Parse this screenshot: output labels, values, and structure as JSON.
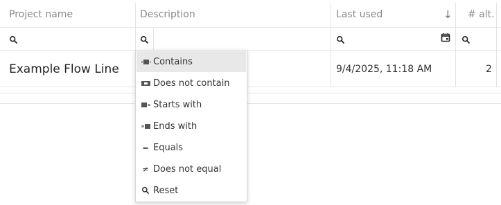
{
  "columns": {
    "project_name": "Project name",
    "description": "Description",
    "last_used": "Last used",
    "alt_count": "# alt."
  },
  "sort": {
    "indicator": "↓"
  },
  "rows": [
    {
      "project_name": "Example Flow Line",
      "last_used": "9/4/2025, 11:18 AM",
      "alt_count": "2"
    }
  ],
  "filter_menu": {
    "items": [
      {
        "label": "Contains",
        "icon": "contains-icon",
        "selected": true
      },
      {
        "label": "Does not contain",
        "icon": "does-not-contain-icon",
        "selected": false
      },
      {
        "label": "Starts with",
        "icon": "starts-with-icon",
        "selected": false
      },
      {
        "label": "Ends with",
        "icon": "ends-with-icon",
        "selected": false
      },
      {
        "label": "Equals",
        "icon": "equals-icon",
        "glyph": "=",
        "selected": false
      },
      {
        "label": "Does not equal",
        "icon": "not-equal-icon",
        "glyph": "≠",
        "selected": false
      },
      {
        "label": "Reset",
        "icon": "search-icon",
        "selected": false
      }
    ]
  },
  "colors": {
    "selected_item_bg": "#e8e8e8",
    "grid_line": "#e3e3e3",
    "header_text": "#8a8a8a"
  }
}
